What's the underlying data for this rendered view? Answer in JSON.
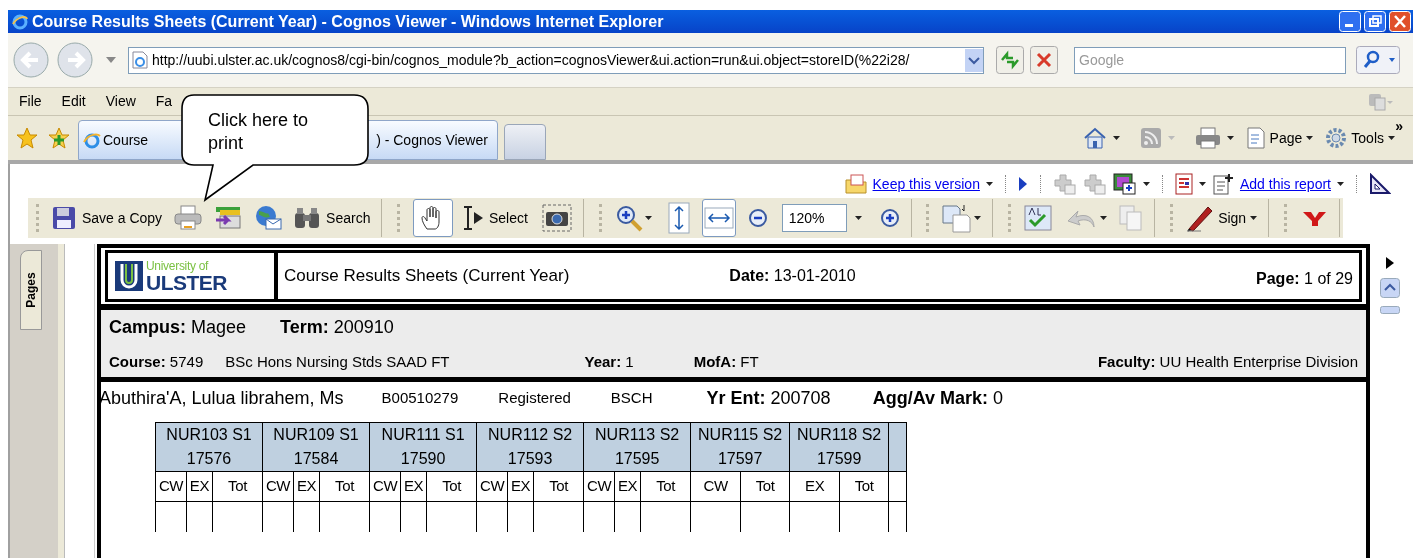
{
  "window": {
    "title": "Course Results Sheets (Current Year) - Cognos Viewer - Windows Internet Explorer"
  },
  "address_bar": {
    "url": "http://uubi.ulster.ac.uk/cognos8/cgi-bin/cognos_module?b_action=cognosViewer&ui.action=run&ui.object=storeID(%22i28/",
    "search_placeholder": "Google"
  },
  "menu": [
    "File",
    "Edit",
    "View",
    "Fa"
  ],
  "tabs": [
    {
      "texts": [
        "Course",
        ") - Cognos Viewer"
      ],
      "selected": true
    },
    {
      "selected": false
    }
  ],
  "command_bar": {
    "page": "Page",
    "tools": "Tools",
    "more": "»"
  },
  "callout": {
    "text": "Click here to print"
  },
  "viewer_links": [
    "Keep this version",
    "Add this report"
  ],
  "toolbar": {
    "save": "Save a Copy",
    "search": "Search",
    "hand_pressed": true,
    "select": "Select",
    "fit_width_pressed": true,
    "zoom": "120%",
    "sign": "Sign"
  },
  "pages_tab": "Pages",
  "report": {
    "logo": {
      "top": "University of",
      "bottom": "ULSTER"
    },
    "title": "Course Results Sheets (Current Year)",
    "date": {
      "label": "Date:",
      "value": "13-01-2010"
    },
    "page": {
      "label": "Page:",
      "value": "1 of 29"
    },
    "campus": {
      "label": "Campus:",
      "value": "Magee"
    },
    "term": {
      "label": "Term:",
      "value": "200910"
    },
    "course": {
      "label": "Course:",
      "value": "5749"
    },
    "course_name": "BSc Hons Nursing Stds SAAD FT",
    "year": {
      "label": "Year:",
      "value": "1"
    },
    "mofa": {
      "label": "MofA:",
      "value": "FT"
    },
    "faculty": {
      "label": "Faculty:",
      "value": "UU Health Enterprise Division"
    },
    "student": {
      "name": "Abuthira'A, Lulua librahem, Ms",
      "id": "B00510279",
      "status": "Registered",
      "programme": "BSCH",
      "yr_ent": {
        "label": "Yr Ent:",
        "value": "200708"
      },
      "agg": {
        "label": "Agg/Av Mark:",
        "value": "0"
      }
    },
    "modules": [
      {
        "code": "NUR103 S1",
        "number": "17576",
        "parts": [
          "CW",
          "EX",
          "Tot"
        ]
      },
      {
        "code": "NUR109 S1",
        "number": "17584",
        "parts": [
          "CW",
          "EX",
          "Tot"
        ]
      },
      {
        "code": "NUR111 S1",
        "number": "17590",
        "parts": [
          "CW",
          "EX",
          "Tot"
        ]
      },
      {
        "code": "NUR112 S2",
        "number": "17593",
        "parts": [
          "CW",
          "EX",
          "Tot"
        ]
      },
      {
        "code": "NUR113 S2",
        "number": "17595",
        "parts": [
          "CW",
          "EX",
          "Tot"
        ]
      },
      {
        "code": "NUR115 S2",
        "number": "17597",
        "parts": [
          "CW",
          "Tot"
        ]
      },
      {
        "code": "NUR118 S2",
        "number": "17599",
        "parts": [
          "EX",
          "Tot"
        ]
      }
    ]
  }
}
